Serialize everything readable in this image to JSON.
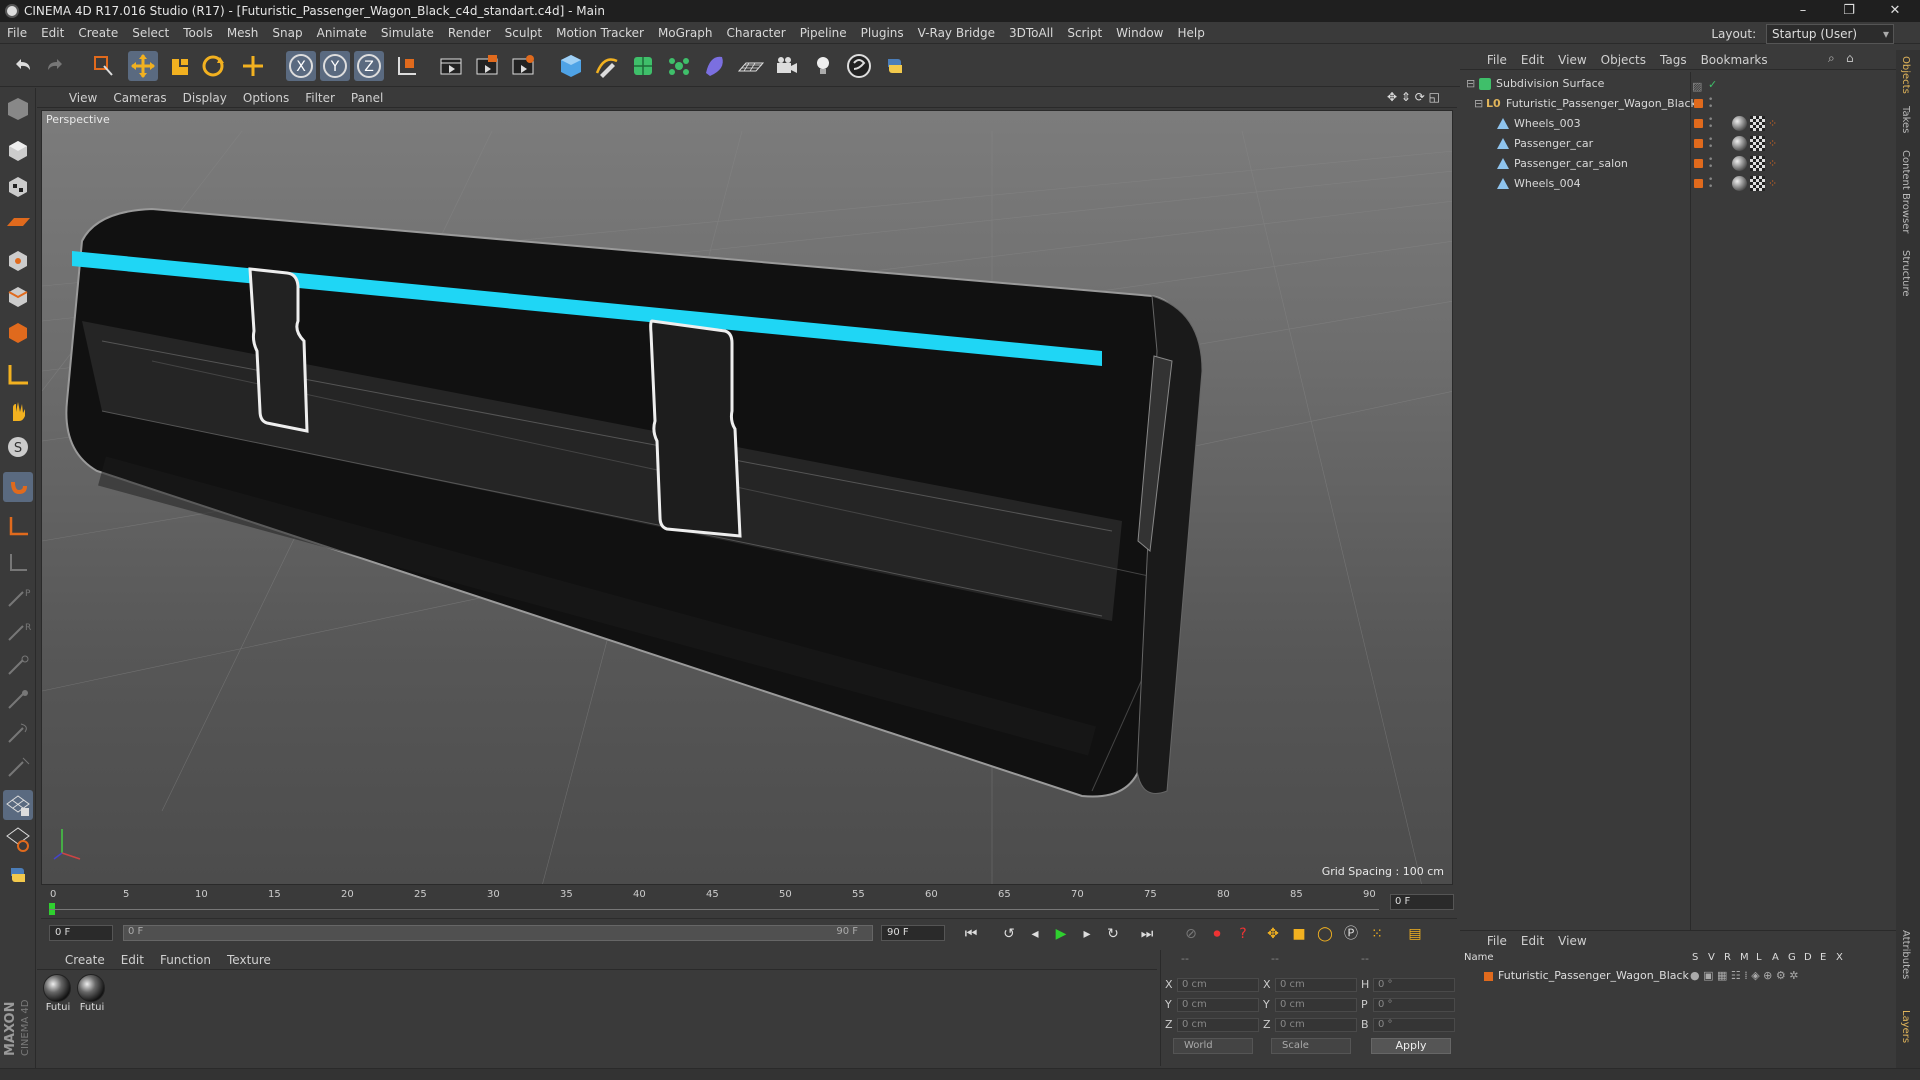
{
  "window": {
    "title": "CINEMA 4D R17.016 Studio (R17) - [Futuristic_Passenger_Wagon_Black_c4d_standart.c4d] - Main",
    "minimize": "–",
    "maximize": "❐",
    "close": "✕"
  },
  "menubar": {
    "items": [
      "File",
      "Edit",
      "Create",
      "Select",
      "Tools",
      "Mesh",
      "Snap",
      "Animate",
      "Simulate",
      "Render",
      "Sculpt",
      "Motion Tracker",
      "MoGraph",
      "Character",
      "Pipeline",
      "Plugins",
      "V-Ray Bridge",
      "3DToAll",
      "Script",
      "Window",
      "Help"
    ],
    "layout_label": "Layout:",
    "layout_value": "Startup (User)"
  },
  "toolbar": {
    "icons": [
      "undo-icon",
      "redo-icon",
      "live-selection-icon",
      "move-icon",
      "scale-icon",
      "rotate-icon",
      "multi-transform-icon",
      "x-axis-icon",
      "y-axis-icon",
      "z-axis-icon",
      "coordinate-system-icon",
      "render-view-icon",
      "render-picture-viewer-icon",
      "edit-render-settings-icon",
      "cube-icon",
      "pen-spline-icon",
      "subdivision-surface-icon",
      "array-icon",
      "deformer-icon",
      "floor-icon",
      "camera-icon",
      "light-icon",
      "python-generator-icon",
      "python-icon"
    ]
  },
  "viewport": {
    "menu": [
      "View",
      "Cameras",
      "Display",
      "Options",
      "Filter",
      "Panel"
    ],
    "label": "Perspective",
    "grid_spacing": "Grid Spacing : 100 cm"
  },
  "timeline": {
    "ticks": [
      "0",
      "5",
      "10",
      "15",
      "20",
      "25",
      "30",
      "35",
      "40",
      "45",
      "50",
      "55",
      "60",
      "65",
      "70",
      "75",
      "80",
      "85",
      "90"
    ],
    "current_frame": "0 F"
  },
  "transport": {
    "start": "0 F",
    "range_start": "0 F",
    "range_end": "90 F",
    "end": "90 F"
  },
  "material_manager": {
    "menu": [
      "Create",
      "Edit",
      "Function",
      "Texture"
    ],
    "materials": [
      "Futui",
      "Futui"
    ]
  },
  "coordinates": {
    "header": [
      "--",
      "--",
      "--"
    ],
    "rows": [
      {
        "a": "X",
        "a_val": "0 cm",
        "b": "X",
        "b_val": "0 cm",
        "c": "H",
        "c_val": "0 °"
      },
      {
        "a": "Y",
        "a_val": "0 cm",
        "b": "Y",
        "b_val": "0 cm",
        "c": "P",
        "c_val": "0 °"
      },
      {
        "a": "Z",
        "a_val": "0 cm",
        "b": "Z",
        "b_val": "0 cm",
        "c": "B",
        "c_val": "0 °"
      }
    ],
    "world": "World",
    "scale": "Scale",
    "apply": "Apply"
  },
  "object_manager": {
    "menu": [
      "File",
      "Edit",
      "View",
      "Objects",
      "Tags",
      "Bookmarks"
    ],
    "objects": [
      {
        "name": "Subdivision Surface"
      },
      {
        "name": "Futuristic_Passenger_Wagon_Black"
      },
      {
        "name": "Wheels_003"
      },
      {
        "name": "Passenger_car"
      },
      {
        "name": "Passenger_car_salon"
      },
      {
        "name": "Wheels_004"
      }
    ]
  },
  "layer_manager": {
    "menu": [
      "File",
      "Edit",
      "View"
    ],
    "columns": [
      "Name",
      "S",
      "V",
      "R",
      "M",
      "L",
      "A",
      "G",
      "D",
      "E",
      "X"
    ],
    "layer": "Futuristic_Passenger_Wagon_Black"
  },
  "side_tabs": [
    "Objects",
    "Takes",
    "Content Browser",
    "Structure",
    "Attributes",
    "Layers"
  ],
  "maxon_logo": "MAXON CINEMA 4D",
  "colors": {
    "accent": "#e06a1d",
    "neon": "#1fd6f5",
    "active_tool": "#5a6a80"
  }
}
